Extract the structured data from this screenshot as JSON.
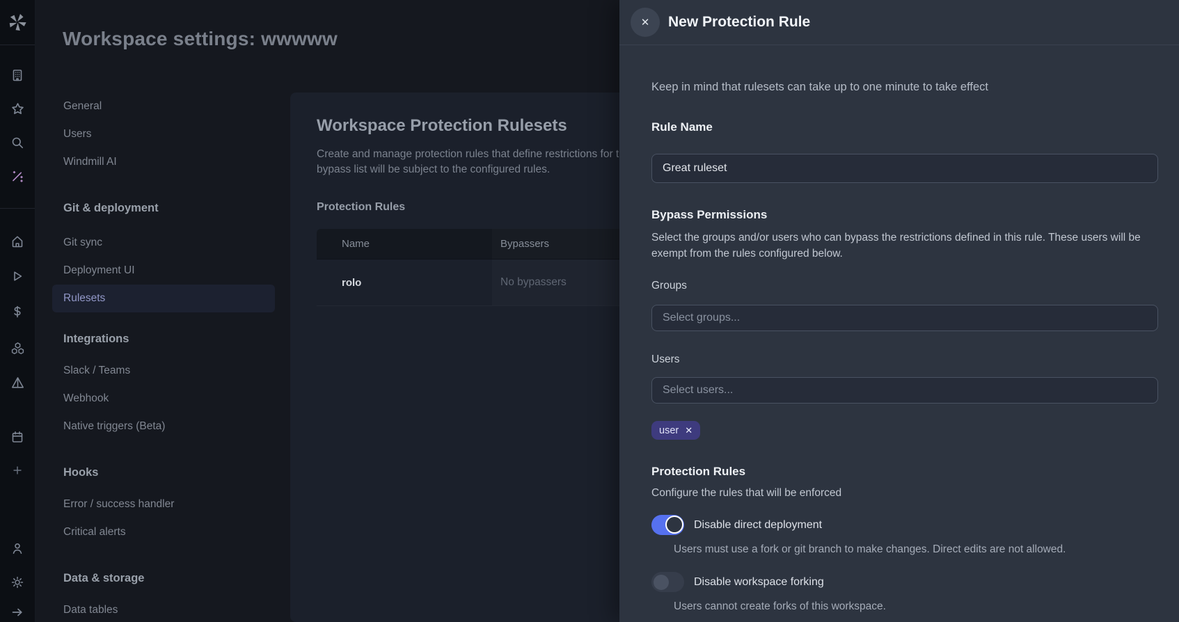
{
  "colors": {
    "accent": "#5671ef",
    "chip-bg": "#3e3b7e",
    "wand": "#b48cc8"
  },
  "window": {
    "title": "Workspace settings: wwwww"
  },
  "sidebar": {
    "icons": [
      "windmill-logo",
      "workspaces-building",
      "favorites-star",
      "search",
      "windmill-ai-wand",
      "home",
      "runs-play",
      "billing-dollar",
      "resources-boxes",
      "schedules-pyramid",
      "calendar",
      "create-new-plus",
      "account-user",
      "settings-gear",
      "log-out-arrow"
    ]
  },
  "nav": {
    "active_item": "Rulesets",
    "sections": [
      {
        "heading": "",
        "items": [
          {
            "label": "General"
          },
          {
            "label": "Users"
          },
          {
            "label": "Windmill AI"
          }
        ]
      },
      {
        "heading": "Git & deployment",
        "items": [
          {
            "label": "Git sync"
          },
          {
            "label": "Deployment UI"
          },
          {
            "label": "Rulesets"
          }
        ]
      },
      {
        "heading": "Integrations",
        "items": [
          {
            "label": "Slack / Teams"
          },
          {
            "label": "Webhook"
          },
          {
            "label": "Native triggers (Beta)"
          }
        ]
      },
      {
        "heading": "Hooks",
        "items": [
          {
            "label": "Error / success handler"
          },
          {
            "label": "Critical alerts"
          }
        ]
      },
      {
        "heading": "Data & storage",
        "items": [
          {
            "label": "Data tables"
          }
        ]
      }
    ]
  },
  "main": {
    "heading": "Workspace Protection Rulesets",
    "description_line1": "Create and manage protection rules that define restrictions for this workspace. Users not in the",
    "description_line2": "bypass list will be subject to the configured rules.",
    "rules_label": "Protection Rules",
    "table": {
      "columns": [
        "Name",
        "Bypassers"
      ],
      "rows": [
        {
          "name": "rolo",
          "bypassers": "No bypassers"
        }
      ]
    }
  },
  "drawer": {
    "title": "New Protection Rule",
    "note": "Keep in mind that rulesets can take up to one minute to take effect",
    "rule_name": {
      "label": "Rule Name",
      "value": "Great ruleset"
    },
    "bypass": {
      "heading": "Bypass Permissions",
      "description": "Select the groups and/or users who can bypass the restrictions defined in this rule. These users will be exempt from the rules configured below.",
      "groups_label": "Groups",
      "groups_placeholder": "Select groups...",
      "users_label": "Users",
      "users_placeholder": "Select users...",
      "selected_users": [
        {
          "name": "user"
        }
      ]
    },
    "rules": {
      "heading": "Protection Rules",
      "description": "Configure the rules that will be enforced",
      "toggles": [
        {
          "label": "Disable direct deployment",
          "description": "Users must use a fork or git branch to make changes. Direct edits are not allowed.",
          "enabled": true
        },
        {
          "label": "Disable workspace forking",
          "description": "Users cannot create forks of this workspace.",
          "enabled": false
        }
      ]
    }
  }
}
